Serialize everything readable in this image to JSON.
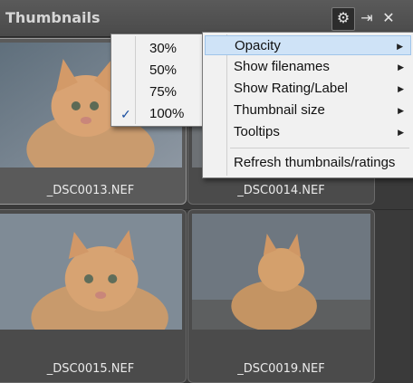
{
  "panel": {
    "title": "Thumbnails",
    "buttons": [
      {
        "icon": "gear-icon",
        "glyph": "⚙"
      },
      {
        "icon": "dock-icon",
        "glyph": "⇥"
      },
      {
        "icon": "close-icon",
        "glyph": "✕"
      }
    ]
  },
  "thumbnails": [
    {
      "filename": "_DSC0013.NEF",
      "selected": true
    },
    {
      "filename": "_DSC0014.NEF",
      "selected": false
    },
    {
      "filename": "_DSC0015.NEF",
      "selected": false
    },
    {
      "filename": "_DSC0019.NEF",
      "selected": false
    }
  ],
  "main_menu": {
    "items": [
      {
        "label": "Opacity",
        "submenu": true,
        "highlighted": true
      },
      {
        "label": "Show filenames",
        "submenu": true
      },
      {
        "label": "Show Rating/Label",
        "submenu": true
      },
      {
        "label": "Thumbnail size",
        "submenu": true
      },
      {
        "label": "Tooltips",
        "submenu": true
      },
      {
        "label": "Refresh thumbnails/ratings",
        "submenu": false
      }
    ]
  },
  "opacity_menu": {
    "items": [
      {
        "label": "30%",
        "checked": false
      },
      {
        "label": "50%",
        "checked": false
      },
      {
        "label": "75%",
        "checked": false
      },
      {
        "label": "100%",
        "checked": true
      }
    ],
    "check_glyph": "✓"
  },
  "colors": {
    "menu_highlight": "#cfe3f7",
    "check": "#1a4fa0"
  }
}
